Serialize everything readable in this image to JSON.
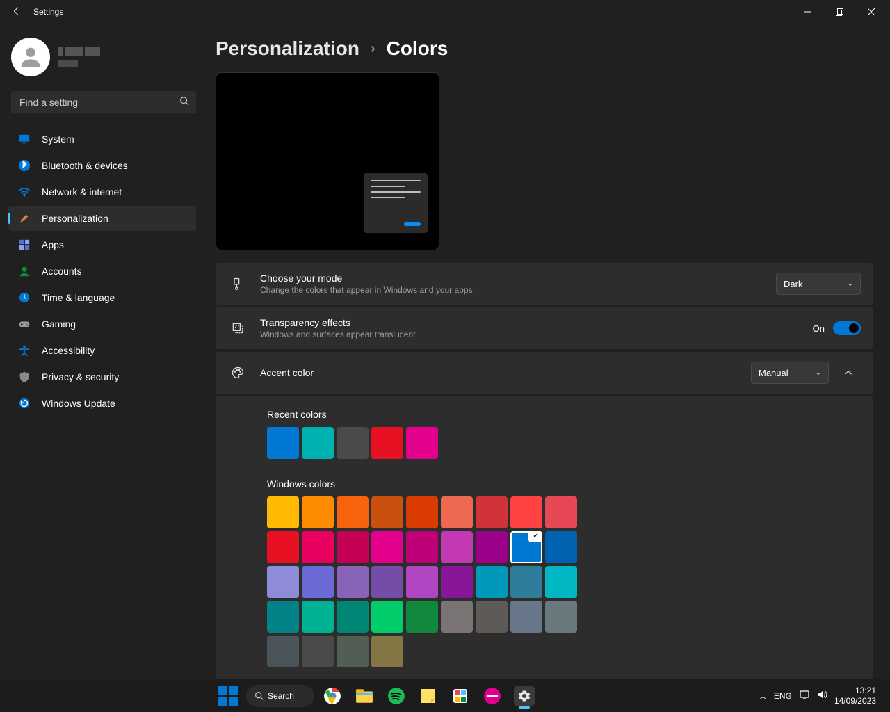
{
  "window": {
    "title": "Settings"
  },
  "user": {
    "name_redacted": true,
    "email_redacted": true
  },
  "search": {
    "placeholder": "Find a setting"
  },
  "nav": {
    "items": [
      {
        "label": "System",
        "icon": "monitor",
        "icon_color": "#0078d4"
      },
      {
        "label": "Bluetooth & devices",
        "icon": "bluetooth",
        "icon_color": "#0078d4"
      },
      {
        "label": "Network & internet",
        "icon": "wifi",
        "icon_color": "#0078d4"
      },
      {
        "label": "Personalization",
        "icon": "brush",
        "icon_color": "#d97d3a",
        "selected": true
      },
      {
        "label": "Apps",
        "icon": "apps",
        "icon_color": "#5a6fbf"
      },
      {
        "label": "Accounts",
        "icon": "account",
        "icon_color": "#10893e"
      },
      {
        "label": "Time & language",
        "icon": "clock",
        "icon_color": "#0078d4"
      },
      {
        "label": "Gaming",
        "icon": "gamepad",
        "icon_color": "#9a9a9a"
      },
      {
        "label": "Accessibility",
        "icon": "accessibility",
        "icon_color": "#0078d4"
      },
      {
        "label": "Privacy & security",
        "icon": "shield",
        "icon_color": "#8a8a8a"
      },
      {
        "label": "Windows Update",
        "icon": "update",
        "icon_color": "#0078d4"
      }
    ]
  },
  "breadcrumb": {
    "parent": "Personalization",
    "current": "Colors"
  },
  "settings": {
    "mode": {
      "title": "Choose your mode",
      "subtitle": "Change the colors that appear in Windows and your apps",
      "value": "Dark"
    },
    "transparency": {
      "title": "Transparency effects",
      "subtitle": "Windows and surfaces appear translucent",
      "value_label": "On",
      "value": true
    },
    "accent": {
      "title": "Accent color",
      "value": "Manual",
      "expanded": true
    }
  },
  "recent_heading": "Recent colors",
  "recent_colors": [
    "#0078d4",
    "#00b2b2",
    "#4a4a4a",
    "#e81123",
    "#e3008c"
  ],
  "windows_heading": "Windows colors",
  "windows_colors": [
    [
      "#ffb900",
      "#ff8c00",
      "#f7630c",
      "#ca5010",
      "#da3b01",
      "#ef6950",
      "#d13438",
      "#ff4343",
      "#e74856"
    ],
    [
      "#e81123",
      "#ea005e",
      "#c30052",
      "#e3008c",
      "#bf0077",
      "#c239b3",
      "#9a0089",
      "#0078d4",
      "#0063b1"
    ],
    [
      "#8e8cd8",
      "#6b69d6",
      "#8764b8",
      "#744da9",
      "#b146c2",
      "#881798",
      "#0099bc",
      "#2d7d9a",
      "#00b7c3"
    ],
    [
      "#038387",
      "#00b294",
      "#018574",
      "#00cc6a",
      "#10893e",
      "#7a7574",
      "#5d5a58",
      "#68768a",
      "#69797e"
    ],
    [
      "#4a5459",
      "#4c4a48",
      "#525e54",
      "#847545"
    ]
  ],
  "selected_color_index": [
    1,
    7
  ],
  "taskbar": {
    "search_label": "Search",
    "lang": "ENG",
    "time": "13:21",
    "date": "14/09/2023"
  }
}
